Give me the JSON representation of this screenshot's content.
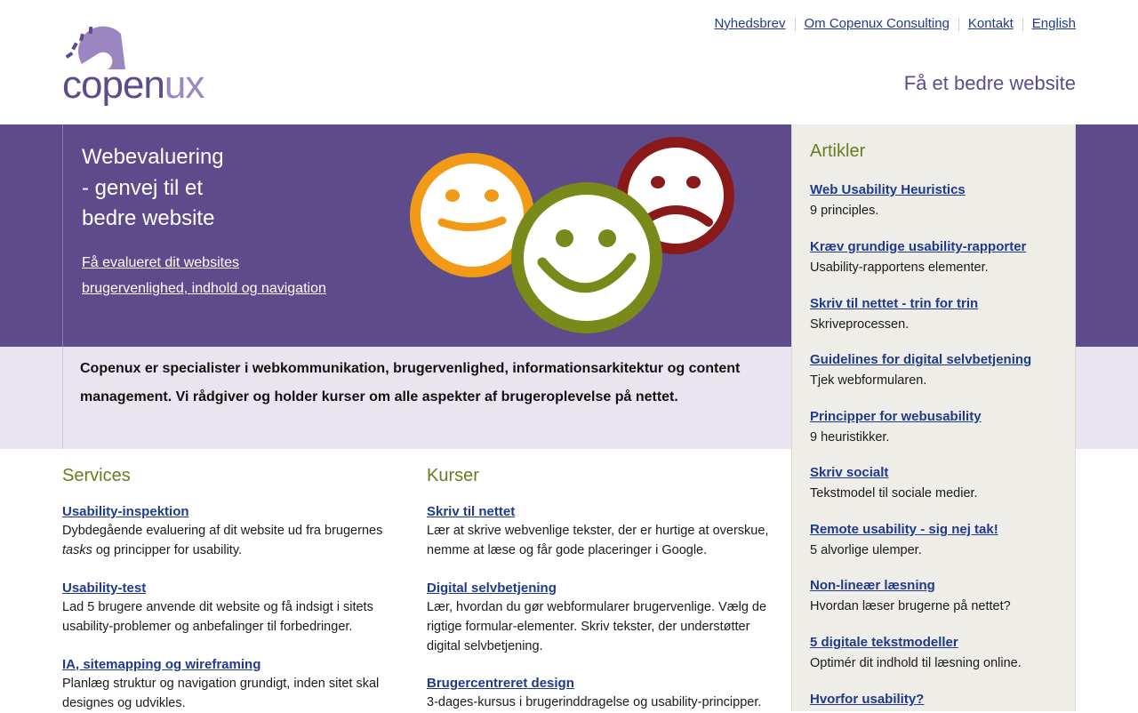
{
  "header": {
    "logo_text_a": "copen",
    "logo_text_b": "ux",
    "nav": [
      "Nyhedsbrev",
      "Om Copenux Consulting",
      "Kontakt",
      "English"
    ],
    "tagline": "Få et bedre website"
  },
  "hero": {
    "title_lines": [
      "Webevaluering",
      "- genvej til et",
      "bedre website"
    ],
    "link_lines": [
      "Få evalueret dit websites",
      "brugervenlighed, indhold og navigation"
    ]
  },
  "intro": {
    "text": "Copenux er specialister i webkommunikation, brugervenlighed, informationsarkitektur og content management. Vi rådgiver og holder kurser om alle aspekter af brugeroplevelse på nettet."
  },
  "services": {
    "title": "Services",
    "items": [
      {
        "title": "Usability-inspektion",
        "desc_a": "Dybdegående evaluering af dit website ud fra brugernes ",
        "desc_em": "tasks",
        "desc_b": " og principper for usability."
      },
      {
        "title": "Usability-test",
        "desc": "Lad 5 brugere anvende dit website og få indsigt i sitets usability-problemer og anbefalinger til forbedringer."
      },
      {
        "title": "IA, sitemapping og wireframing",
        "desc": "Planlæg struktur og navigation grundigt, inden sitet skal designes og udvikles."
      }
    ]
  },
  "courses": {
    "title": "Kurser",
    "items": [
      {
        "title": "Skriv til nettet",
        "desc": "Lær at skrive webvenlige tekster, der er hurtige at overskue, nemme at læse og får gode placeringer i Google."
      },
      {
        "title": "Digital selvbetjening",
        "desc": "Lær, hvordan du gør webformularer brugervenlige. Vælg de rigtige formular-elementer. Skriv tekster, der understøtter digital selvbetjening."
      },
      {
        "title": "Brugercentreret design",
        "desc": "3-dages-kursus i brugerinddragelse og usability-principper."
      }
    ]
  },
  "sidebar": {
    "title": "Artikler",
    "articles": [
      {
        "title": "Web Usability Heuristics",
        "desc": "9 principles."
      },
      {
        "title": "Kræv grundige usability-rapporter",
        "desc": "Usability-rapportens elementer."
      },
      {
        "title": "Skriv til nettet - trin for trin",
        "desc": "Skriveprocessen."
      },
      {
        "title": "Guidelines for digital selvbetjening",
        "desc": "Tjek webformularen."
      },
      {
        "title": "Principper for webusability",
        "desc": "9 heuristikker."
      },
      {
        "title": "Skriv socialt",
        "desc": "Tekstmodel til sociale medier."
      },
      {
        "title": "Remote usability - sig nej tak!",
        "desc": "5 alvorlige ulemper."
      },
      {
        "title": "Non-lineær læsning",
        "desc": "Hvordan læser brugerne på nettet?"
      },
      {
        "title": "5 digitale tekstmodeller",
        "desc": "Optimér dit indhold til læsning online."
      },
      {
        "title": "Hvorfor usability?",
        "desc": ""
      }
    ]
  },
  "colors": {
    "brand_purple": "#5e4b8b",
    "light_purple": "#e9e4f0",
    "heading_green": "#6b7c1f",
    "link_blue": "#1f3a8a"
  }
}
